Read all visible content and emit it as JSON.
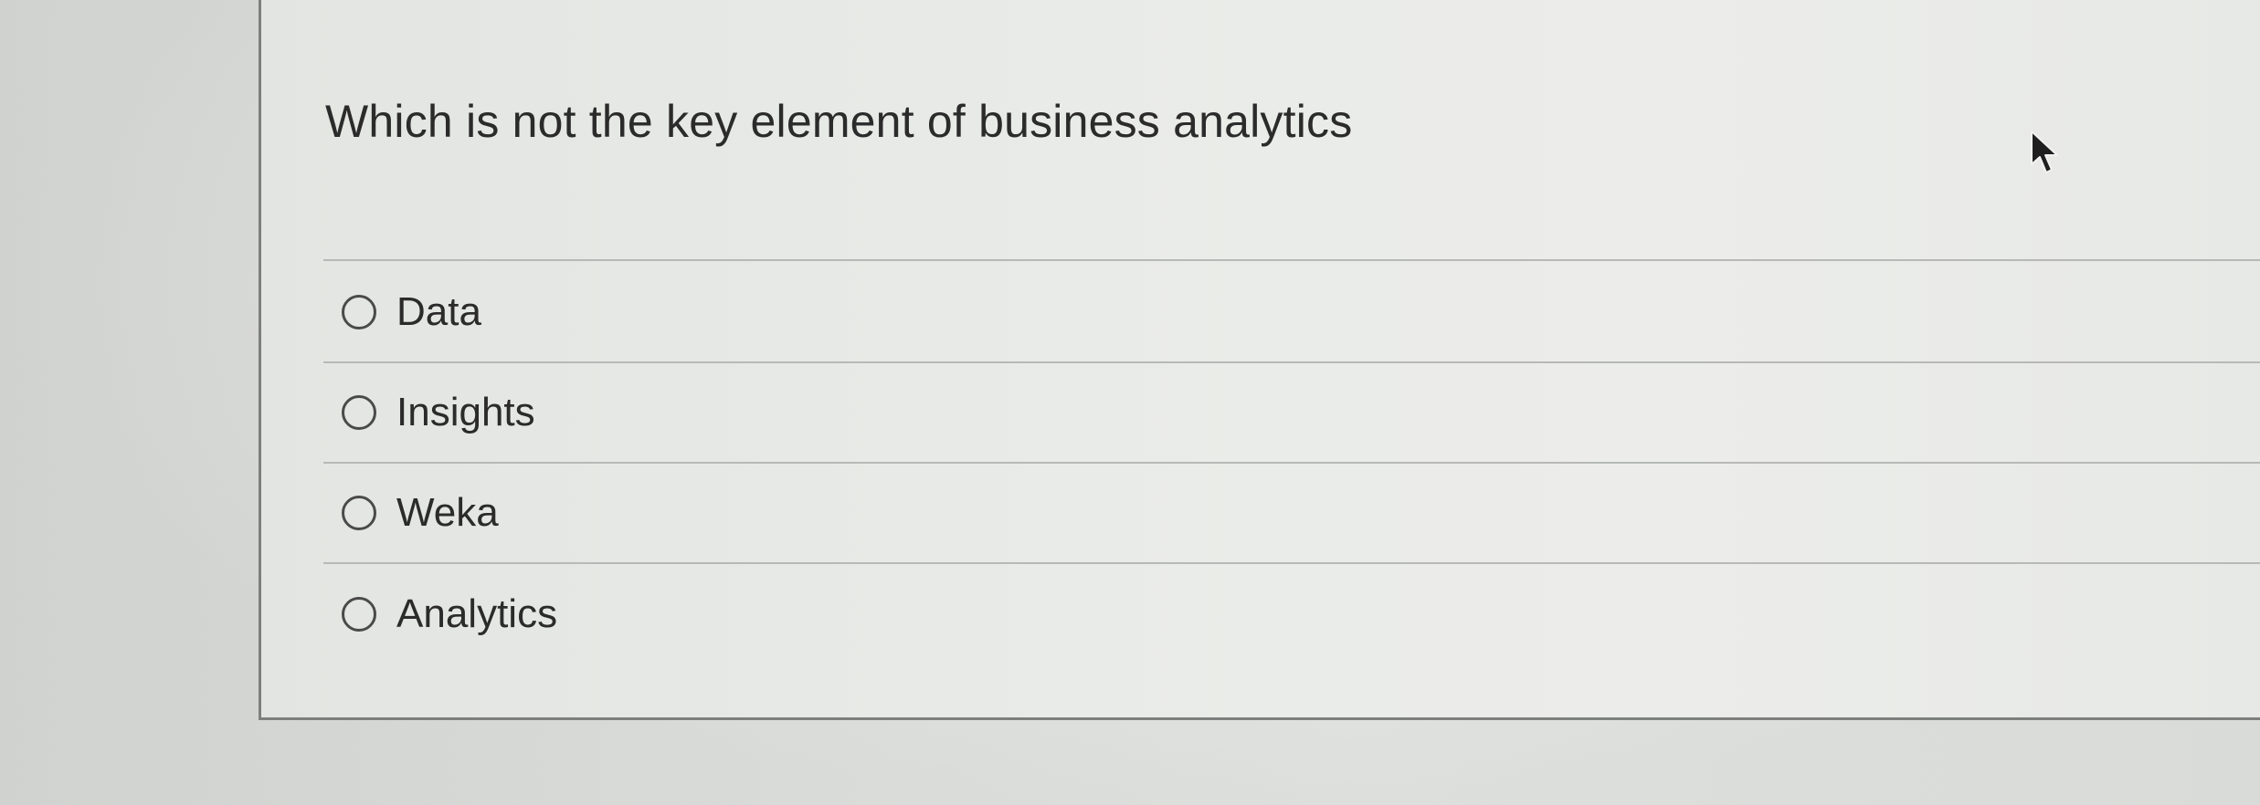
{
  "question": {
    "text": "Which is not the key element of business analytics"
  },
  "answers": [
    {
      "label": "Data",
      "selected": false
    },
    {
      "label": "Insights",
      "selected": false
    },
    {
      "label": "Weka",
      "selected": false
    },
    {
      "label": "Analytics",
      "selected": false
    }
  ],
  "icons": {
    "radio": "radio-unselected-icon",
    "cursor": "mouse-pointer-icon"
  },
  "colors": {
    "text": "#2b2b2b",
    "border": "#7d7f7c",
    "divider": "#b7b9b6",
    "radio": "#4a4a4a"
  }
}
